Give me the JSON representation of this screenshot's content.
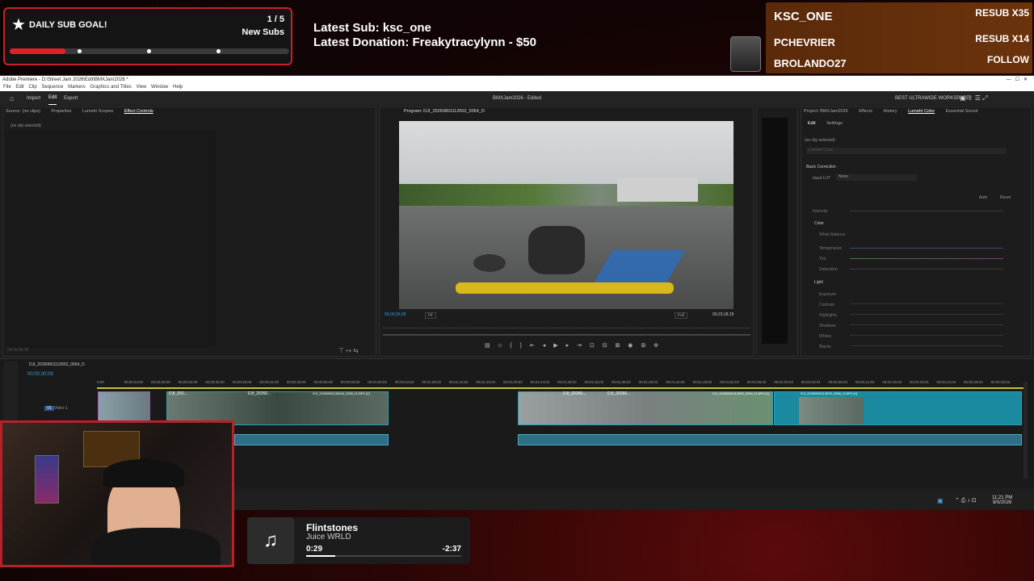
{
  "overlay": {
    "sub_goal": {
      "title": "DAILY SUB GOAL!",
      "count": "1 / 5",
      "label": "New Subs",
      "progress": 0.2
    },
    "latest_sub": "Latest Sub: ksc_one",
    "latest_donation": "Latest Donation: Freakytracylynn  - $50",
    "recent": [
      {
        "name": "KSC_ONE",
        "value": "RESUB X35"
      },
      {
        "name": "PCHEVRIER",
        "value": "RESUB X14"
      },
      {
        "name": "BROLANDO27",
        "value": "FOLLOW"
      }
    ]
  },
  "premiere": {
    "window_title": "Adobe Premiere - D:\\Street Jam 2026\\Edit\\BMXJam2026 *",
    "menu": [
      "File",
      "Edit",
      "Clip",
      "Sequence",
      "Markers",
      "Graphics and Titles",
      "View",
      "Window",
      "Help"
    ],
    "top_tabs": [
      "Import",
      "Edit",
      "Export"
    ],
    "project_title": "BMXJam2026 - Edited",
    "workspace": "BEST ULTRAWIDE WORKSPACE",
    "source_tabs": [
      "Source: (no clips)",
      "Properties",
      "Lumetri Scopes",
      "Effect Controls"
    ],
    "no_clip": "(no clip selected)",
    "source_timecode": "00;00;00;00",
    "program_title": "Program: DJI_20260801112652_0064_D",
    "program_timecode": "00;00;30;08",
    "fit": "Fit",
    "full": "Full",
    "duration": "00;23;18;19",
    "right_tabs": [
      "Project: BMXJam2026",
      "Effects",
      "History",
      "Lumetri Color",
      "Essential Sound"
    ],
    "lumetri": {
      "subtabs": [
        "Edit",
        "Settings"
      ],
      "no_clip": "(no clip selected)",
      "dropdown": "Lumetri Color",
      "basic": "Basic Correction",
      "input_lut": "Input LUT",
      "lut_value": "None",
      "auto": "Auto",
      "reset": "Reset",
      "intensity": "Intensity",
      "color": "Color",
      "white_balance": "White Balance",
      "color_rows": [
        "Temperature",
        "Tint",
        "Saturation"
      ],
      "light": "Light",
      "light_rows": [
        "Exposure",
        "Contrast",
        "Highlights",
        "Shadows",
        "Whites",
        "Blacks"
      ]
    },
    "sequence_tab": "DJI_20260801112652_0064_D",
    "seq_timecode": "00;00;30;08",
    "ruler": [
      "0;00",
      "00;00;24;00",
      "00;00;28;00",
      "00;00;32;00",
      "00;00;36;00",
      "00;00;40;00",
      "00;00;44;00",
      "00;00;48;00",
      "00;00;52;00",
      "00;00;56;00",
      "00;01;00;02",
      "00;01;04;02",
      "00;01;08;02",
      "00;01;12;02",
      "00;01;16;02",
      "00;01;20;02",
      "00;01;24;02",
      "00;01;28;02",
      "00;01;32;02",
      "00;01;36;02",
      "00;01;40;02",
      "00;01;44;02",
      "00;01;48;02",
      "00;01;52;02",
      "00;01;56;02",
      "00;02;00;04",
      "00;02;04;04",
      "00;02;08;04",
      "00;02;12;04",
      "00;02;16;04",
      "00;02;20;04",
      "00;02;24;04",
      "00;02;28;04",
      "00;02;32;04"
    ],
    "track_v1": "V1",
    "track_label": "Video 1",
    "clip_labels": [
      "DJI_202...",
      "DJI_20260...",
      "DJI_20260801140644_0030_D.MP4 [V]",
      "DJI_20260...",
      "DJI_20260...",
      "DJI_20260801112652_0064_D.MP4 [V]",
      "DJI_20260801113639_0065_D.MP4 [V]"
    ]
  },
  "taskbar": {
    "time": "11:21 PM",
    "date": "8/5/2026"
  },
  "music": {
    "title": "Flintstones",
    "artist": "Juice WRLD",
    "elapsed": "0:29",
    "remaining": "-2:37",
    "progress": 0.19
  }
}
